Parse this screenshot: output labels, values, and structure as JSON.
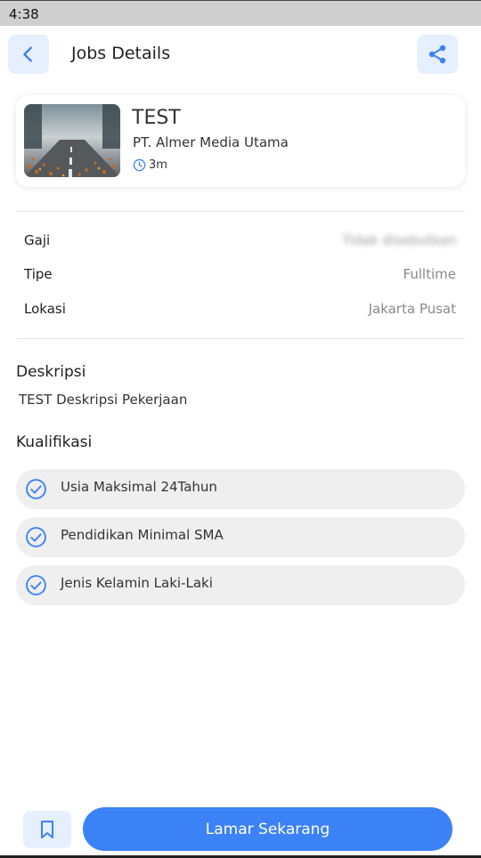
{
  "status_bar": {
    "time": "4:38"
  },
  "header": {
    "title": "Jobs Details",
    "back_icon": "chevron-left-icon",
    "share_icon": "share-icon"
  },
  "job": {
    "title": "TEST",
    "company": "PT. Almer Media Utama",
    "posted": "3m",
    "image": "road-autumn-photo"
  },
  "info": [
    {
      "label": "Gaji",
      "value": "Tidak disebutkan"
    },
    {
      "label": "Tipe",
      "value": "Fulltime"
    },
    {
      "label": "Lokasi",
      "value": "Jakarta Pusat"
    }
  ],
  "description": {
    "heading": "Deskripsi",
    "text": "TEST Deskripsi Pekerjaan"
  },
  "qualifications": {
    "heading": "Kualifikasi",
    "items": [
      "Usia Maksimal 24Tahun",
      "Pendidikan Minimal SMA",
      "Jenis Kelamin Laki-Laki"
    ]
  },
  "actions": {
    "apply_label": "Lamar Sekarang",
    "bookmark_icon": "bookmark-icon"
  },
  "colors": {
    "accent": "#3b82f6",
    "icon_button_bg": "#e6effd",
    "qual_bg": "#efefef"
  }
}
